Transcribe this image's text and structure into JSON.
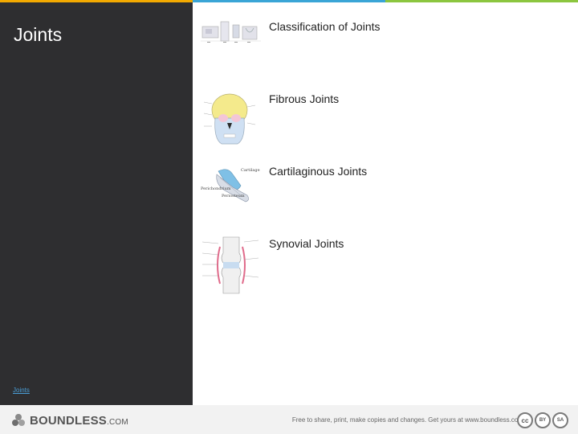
{
  "colors": {
    "topbar": [
      "#f2a900",
      "#3aa5d6",
      "#8cc63f"
    ],
    "sidebar_bg": "#2e2e30",
    "link": "#4a9fd8"
  },
  "sidebar": {
    "title": "Joints",
    "link_label": "Joints"
  },
  "content": {
    "items": [
      {
        "label": "Classification of Joints",
        "icon": "skeleton-joints-thumbnail"
      },
      {
        "label": "Fibrous Joints",
        "icon": "skull-thumbnail"
      },
      {
        "label": "Cartilaginous Joints",
        "icon": "cartilage-bone-thumbnail"
      },
      {
        "label": "Synovial Joints",
        "icon": "synovial-joint-thumbnail"
      }
    ],
    "diagram_labels": {
      "cartilage": "Cartilage",
      "perichondrium": "Perichondrium",
      "periosteum": "Periosteum"
    }
  },
  "footer": {
    "logo_main": "BOUNDLESS",
    "logo_suffix": ".COM",
    "note": "Free to share, print, make copies and changes. Get yours at www.boundless.com",
    "license": {
      "cc": "cc",
      "by": "BY",
      "sa": "SA"
    }
  }
}
